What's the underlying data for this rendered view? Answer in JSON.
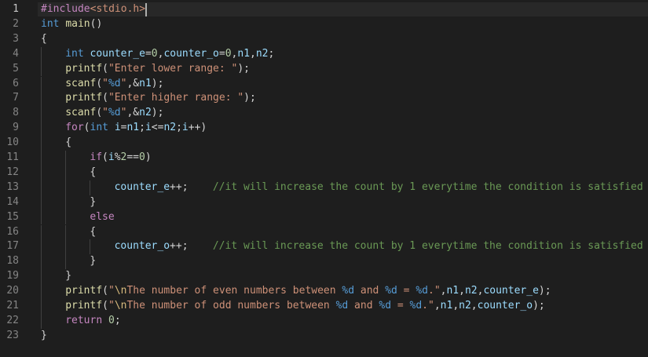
{
  "editor": {
    "language": "c",
    "active_line": 1,
    "colors": {
      "background": "#1e1e1e",
      "line_number": "#858585",
      "keyword": "#569cd6",
      "control": "#c586c0",
      "function": "#dcdcaa",
      "string": "#ce9178",
      "variable": "#9cdcfe",
      "number": "#b5cea8",
      "comment": "#6a9955"
    },
    "lines": [
      {
        "n": "1",
        "indent": 0,
        "tokens": [
          [
            "pre",
            "#include"
          ],
          [
            "str",
            "<stdio.h>"
          ]
        ]
      },
      {
        "n": "2",
        "indent": 0,
        "tokens": [
          [
            "kw",
            "int"
          ],
          [
            "pun",
            " "
          ],
          [
            "fn",
            "main"
          ],
          [
            "pun",
            "()"
          ]
        ]
      },
      {
        "n": "3",
        "indent": 0,
        "tokens": [
          [
            "pun",
            "{"
          ]
        ]
      },
      {
        "n": "4",
        "indent": 1,
        "tokens": [
          [
            "kw",
            "int"
          ],
          [
            "pun",
            " "
          ],
          [
            "id",
            "counter_e"
          ],
          [
            "op",
            "="
          ],
          [
            "num",
            "0"
          ],
          [
            "pun",
            ","
          ],
          [
            "id",
            "counter_o"
          ],
          [
            "op",
            "="
          ],
          [
            "num",
            "0"
          ],
          [
            "pun",
            ","
          ],
          [
            "id",
            "n1"
          ],
          [
            "pun",
            ","
          ],
          [
            "id",
            "n2"
          ],
          [
            "pun",
            ";"
          ]
        ]
      },
      {
        "n": "5",
        "indent": 1,
        "tokens": [
          [
            "fn",
            "printf"
          ],
          [
            "pun",
            "("
          ],
          [
            "str",
            "\"Enter lower range: \""
          ],
          [
            "pun",
            ");"
          ]
        ]
      },
      {
        "n": "6",
        "indent": 1,
        "tokens": [
          [
            "fn",
            "scanf"
          ],
          [
            "pun",
            "("
          ],
          [
            "str",
            "\""
          ],
          [
            "fmt",
            "%d"
          ],
          [
            "str",
            "\""
          ],
          [
            "pun",
            ","
          ],
          [
            "op",
            "&"
          ],
          [
            "id",
            "n1"
          ],
          [
            "pun",
            ");"
          ]
        ]
      },
      {
        "n": "7",
        "indent": 1,
        "tokens": [
          [
            "fn",
            "printf"
          ],
          [
            "pun",
            "("
          ],
          [
            "str",
            "\"Enter higher range: \""
          ],
          [
            "pun",
            ");"
          ]
        ]
      },
      {
        "n": "8",
        "indent": 1,
        "tokens": [
          [
            "fn",
            "scanf"
          ],
          [
            "pun",
            "("
          ],
          [
            "str",
            "\""
          ],
          [
            "fmt",
            "%d"
          ],
          [
            "str",
            "\""
          ],
          [
            "pun",
            ","
          ],
          [
            "op",
            "&"
          ],
          [
            "id",
            "n2"
          ],
          [
            "pun",
            ");"
          ]
        ]
      },
      {
        "n": "9",
        "indent": 1,
        "tokens": [
          [
            "ctrl",
            "for"
          ],
          [
            "pun",
            "("
          ],
          [
            "kw",
            "int"
          ],
          [
            "pun",
            " "
          ],
          [
            "id",
            "i"
          ],
          [
            "op",
            "="
          ],
          [
            "id",
            "n1"
          ],
          [
            "pun",
            ";"
          ],
          [
            "id",
            "i"
          ],
          [
            "op",
            "<="
          ],
          [
            "id",
            "n2"
          ],
          [
            "pun",
            ";"
          ],
          [
            "id",
            "i"
          ],
          [
            "op",
            "++"
          ],
          [
            "pun",
            ")"
          ]
        ]
      },
      {
        "n": "10",
        "indent": 1,
        "tokens": [
          [
            "pun",
            "{"
          ]
        ]
      },
      {
        "n": "11",
        "indent": 2,
        "tokens": [
          [
            "ctrl",
            "if"
          ],
          [
            "pun",
            "("
          ],
          [
            "id",
            "i"
          ],
          [
            "op",
            "%"
          ],
          [
            "num",
            "2"
          ],
          [
            "op",
            "=="
          ],
          [
            "num",
            "0"
          ],
          [
            "pun",
            ")"
          ]
        ]
      },
      {
        "n": "12",
        "indent": 2,
        "tokens": [
          [
            "pun",
            "{"
          ]
        ]
      },
      {
        "n": "13",
        "indent": 3,
        "tokens": [
          [
            "id",
            "counter_e"
          ],
          [
            "op",
            "++"
          ],
          [
            "pun",
            ";    "
          ],
          [
            "com",
            "//it will increase the count by 1 everytime the condition is satisfied"
          ]
        ]
      },
      {
        "n": "14",
        "indent": 2,
        "tokens": [
          [
            "pun",
            "}"
          ]
        ]
      },
      {
        "n": "15",
        "indent": 2,
        "tokens": [
          [
            "ctrl",
            "else"
          ]
        ]
      },
      {
        "n": "16",
        "indent": 2,
        "tokens": [
          [
            "pun",
            "{"
          ]
        ]
      },
      {
        "n": "17",
        "indent": 3,
        "tokens": [
          [
            "id",
            "counter_o"
          ],
          [
            "op",
            "++"
          ],
          [
            "pun",
            ";    "
          ],
          [
            "com",
            "//it will increase the count by 1 everytime the condition is satisfied"
          ]
        ]
      },
      {
        "n": "18",
        "indent": 2,
        "tokens": [
          [
            "pun",
            "}"
          ]
        ]
      },
      {
        "n": "19",
        "indent": 1,
        "tokens": [
          [
            "pun",
            "}"
          ]
        ]
      },
      {
        "n": "20",
        "indent": 1,
        "tokens": [
          [
            "fn",
            "printf"
          ],
          [
            "pun",
            "("
          ],
          [
            "str",
            "\""
          ],
          [
            "esc",
            "\\n"
          ],
          [
            "str",
            "The number of even numbers between "
          ],
          [
            "fmt",
            "%d"
          ],
          [
            "str",
            " and "
          ],
          [
            "fmt",
            "%d"
          ],
          [
            "str",
            " = "
          ],
          [
            "fmt",
            "%d"
          ],
          [
            "str",
            ".\""
          ],
          [
            "pun",
            ","
          ],
          [
            "id",
            "n1"
          ],
          [
            "pun",
            ","
          ],
          [
            "id",
            "n2"
          ],
          [
            "pun",
            ","
          ],
          [
            "id",
            "counter_e"
          ],
          [
            "pun",
            ");"
          ]
        ]
      },
      {
        "n": "21",
        "indent": 1,
        "tokens": [
          [
            "fn",
            "printf"
          ],
          [
            "pun",
            "("
          ],
          [
            "str",
            "\""
          ],
          [
            "esc",
            "\\n"
          ],
          [
            "str",
            "The number of odd numbers between "
          ],
          [
            "fmt",
            "%d"
          ],
          [
            "str",
            " and "
          ],
          [
            "fmt",
            "%d"
          ],
          [
            "str",
            " = "
          ],
          [
            "fmt",
            "%d"
          ],
          [
            "str",
            ".\""
          ],
          [
            "pun",
            ","
          ],
          [
            "id",
            "n1"
          ],
          [
            "pun",
            ","
          ],
          [
            "id",
            "n2"
          ],
          [
            "pun",
            ","
          ],
          [
            "id",
            "counter_o"
          ],
          [
            "pun",
            ");"
          ]
        ]
      },
      {
        "n": "22",
        "indent": 1,
        "tokens": [
          [
            "ctrl",
            "return"
          ],
          [
            "pun",
            " "
          ],
          [
            "num",
            "0"
          ],
          [
            "pun",
            ";"
          ]
        ]
      },
      {
        "n": "23",
        "indent": 0,
        "tokens": [
          [
            "pun",
            "}"
          ]
        ]
      }
    ]
  }
}
